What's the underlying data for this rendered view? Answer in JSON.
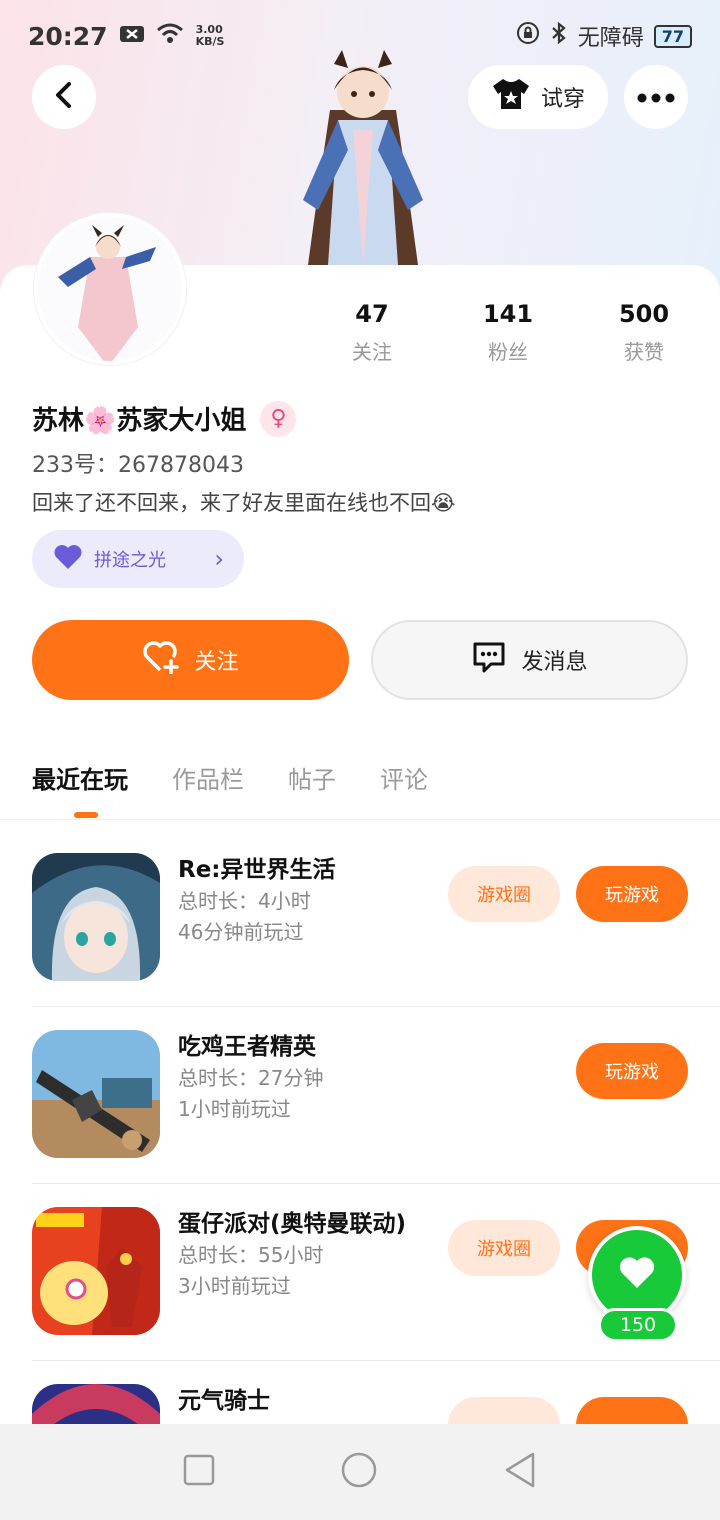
{
  "status_bar": {
    "time": "20:27",
    "net_speed_value": "3.00",
    "net_speed_unit": "KB/S",
    "accessibility": "无障碍",
    "battery": "77"
  },
  "header": {
    "try_on_label": "试穿"
  },
  "stats": [
    {
      "value": "47",
      "label": "关注"
    },
    {
      "value": "141",
      "label": "粉丝"
    },
    {
      "value": "500",
      "label": "获赞"
    }
  ],
  "profile": {
    "nickname": "苏林🌸苏家大小姐",
    "gender_symbol": "♀",
    "uid": "233号：267878043",
    "bio": "回来了还不回来，来了好友里面在线也不回😭",
    "chip_label": "拼途之光"
  },
  "actions": {
    "follow": "关注",
    "message": "发消息"
  },
  "tabs": [
    "最近在玩",
    "作品栏",
    "帖子",
    "评论"
  ],
  "games": [
    {
      "title": "Re:异世界生活",
      "duration": "总时长：4小时",
      "last_played": "46分钟前玩过",
      "circle": "游戏圈",
      "play": "玩游戏",
      "has_circle": true
    },
    {
      "title": "吃鸡王者精英",
      "duration": "总时长：27分钟",
      "last_played": "1小时前玩过",
      "circle": "",
      "play": "玩游戏",
      "has_circle": false
    },
    {
      "title": "蛋仔派对(奥特曼联动)",
      "duration": "总时长：55小时",
      "last_played": "3小时前玩过",
      "circle": "游戏圈",
      "play": "玩游戏",
      "has_circle": true
    },
    {
      "title": "元气骑士",
      "duration": "",
      "last_played": "",
      "circle": "",
      "play": "",
      "has_circle": true
    }
  ],
  "fab": {
    "count": "150"
  },
  "colors": {
    "accent": "#ff7216",
    "fab": "#18c93a",
    "chip": "#6a5bd8"
  }
}
